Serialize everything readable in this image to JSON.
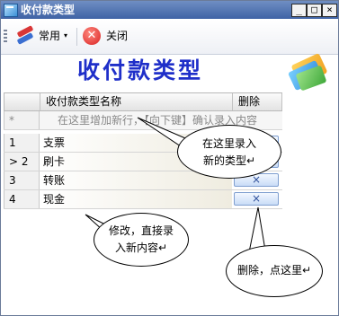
{
  "window": {
    "title": "收付款类型",
    "controls": [
      "_",
      "□",
      "×"
    ]
  },
  "toolbar": {
    "common_label": "常用",
    "common_caret": "▾",
    "close_label": "关闭"
  },
  "heading": "收付款类型",
  "grid": {
    "columns": [
      "收付款类型名称",
      "删除"
    ],
    "new_row_marker": "*",
    "new_row_hint": "在这里增加新行，【向下键】确认录入内容",
    "rows": [
      {
        "index": "1",
        "name": "支票",
        "current": false
      },
      {
        "index": "2",
        "name": "刷卡",
        "current": true
      },
      {
        "index": "3",
        "name": "转账",
        "current": false
      },
      {
        "index": "4",
        "name": "现金",
        "current": false
      }
    ],
    "delete_glyph": "×",
    "current_marker": ">"
  },
  "callouts": {
    "add": [
      "在这里录入",
      "新的类型↵"
    ],
    "edit": [
      "修改，直接录",
      "入新内容↵"
    ],
    "delete": [
      "删除，点这里↵"
    ]
  }
}
